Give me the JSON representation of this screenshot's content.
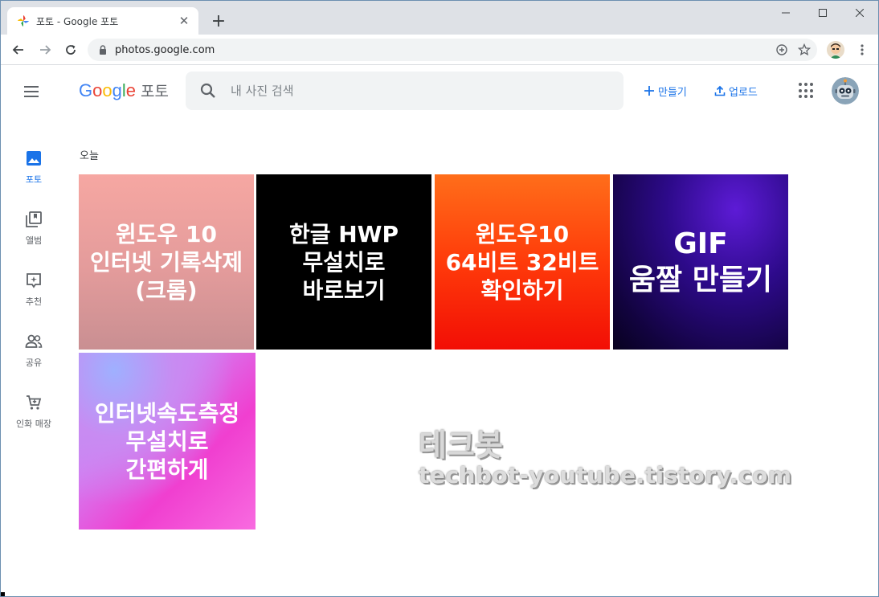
{
  "browser": {
    "tab_title": "포토 - Google 포토",
    "tab_close": "✕",
    "new_tab": "+",
    "url": "photos.google.com"
  },
  "header": {
    "logo_letters": [
      "G",
      "o",
      "o",
      "g",
      "l",
      "e"
    ],
    "product_name": "포토",
    "search_placeholder": "내 사진 검색",
    "create_label": "만들기",
    "upload_label": "업로드"
  },
  "sidebar": {
    "items": [
      {
        "label": "포토",
        "icon": "photo-icon",
        "active": true
      },
      {
        "label": "앨범",
        "icon": "album-icon",
        "active": false
      },
      {
        "label": "추천",
        "icon": "suggest-icon",
        "active": false
      },
      {
        "label": "공유",
        "icon": "people-icon",
        "active": false
      },
      {
        "label": "인화 매장",
        "icon": "cart-icon",
        "active": false
      }
    ]
  },
  "content": {
    "section_label": "오늘",
    "photos": [
      {
        "text": "윈도우 10\n인터넷 기록삭제\n(크롬)"
      },
      {
        "text": "한글 HWP\n무설치로\n 바로보기"
      },
      {
        "text": "윈도우10\n64비트 32비트\n확인하기"
      },
      {
        "text": "GIF\n움짤 만들기"
      },
      {
        "text": "인터넷속도측정\n무설치로\n간편하게"
      }
    ]
  },
  "watermark": {
    "title": "테크봇",
    "url": "techbot-youtube.tistory.com"
  },
  "colors": {
    "accent": "#1a73e8",
    "search_bg": "#f1f3f4",
    "tabstrip_bg": "#dee1e6"
  }
}
